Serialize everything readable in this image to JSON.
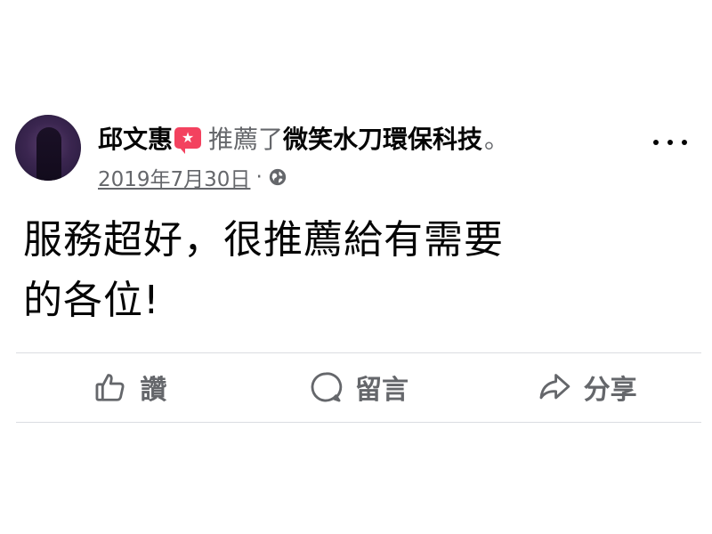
{
  "post": {
    "author": "邱文惠",
    "action_text": "推薦了",
    "page_name": "微笑水刀環保科技",
    "punctuation": "。",
    "date": "2019年7月30日",
    "meta_separator": "·",
    "body_text_line1": "服務超好，很推薦給有需要",
    "body_text_line2": "的各位!"
  },
  "icons": {
    "badge": "recommend-star-icon",
    "more": "more-options-icon",
    "privacy": "globe-icon",
    "like": "thumbs-up-icon",
    "comment": "comment-bubble-icon",
    "share": "share-arrow-icon"
  },
  "actions": {
    "like_label": "讚",
    "comment_label": "留言",
    "share_label": "分享"
  },
  "colors": {
    "badge": "#f3425f",
    "secondary_text": "#65676b",
    "primary_text": "#050505",
    "divider": "#dadde1"
  }
}
